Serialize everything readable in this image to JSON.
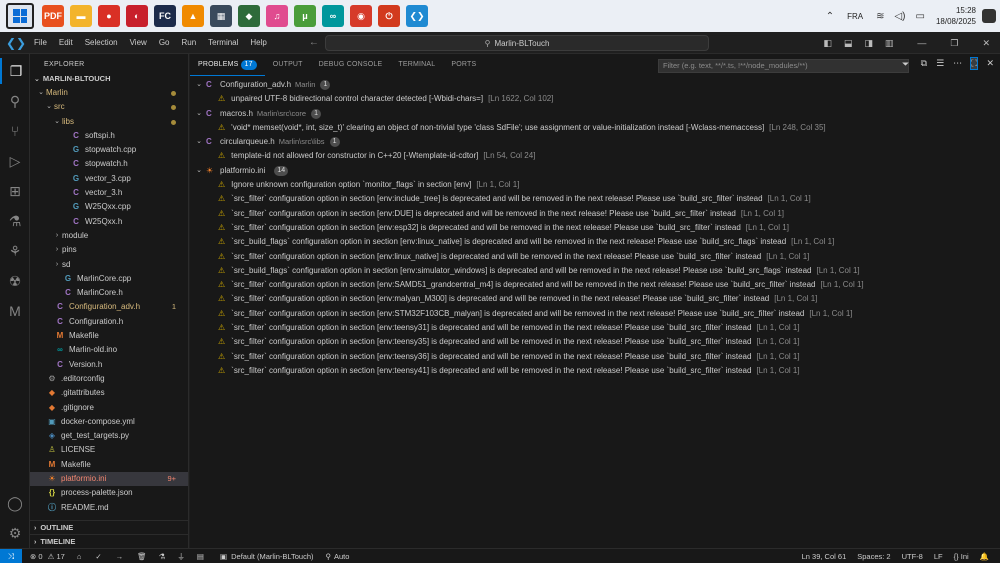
{
  "taskbar": {
    "apps": [
      {
        "icon": "foxit-pdf-icon",
        "glyph": "PDF",
        "color": "#e8501f"
      },
      {
        "icon": "file-explorer-icon",
        "glyph": "▬",
        "color": "#f3b42b"
      },
      {
        "icon": "chrome-icon",
        "glyph": "●",
        "color": "#d93025"
      },
      {
        "icon": "parental-app-icon",
        "glyph": "◐",
        "color": "#c8202c"
      },
      {
        "icon": "fcnx-icon",
        "glyph": "FC",
        "color": "#1c2b4a"
      },
      {
        "icon": "vlc-icon",
        "glyph": "▲",
        "color": "#f08a00"
      },
      {
        "icon": "calculator-icon",
        "glyph": "▦",
        "color": "#3a4a5c"
      },
      {
        "icon": "app-green-icon",
        "glyph": "◆",
        "color": "#2e6b3a"
      },
      {
        "icon": "itunes-icon",
        "glyph": "♫",
        "color": "#e04b8f"
      },
      {
        "icon": "utorrent-icon",
        "glyph": "μ",
        "color": "#4a9d3a"
      },
      {
        "icon": "arduino-icon",
        "glyph": "∞",
        "color": "#00979c"
      },
      {
        "icon": "app-red-icon",
        "glyph": "◉",
        "color": "#d63a2a"
      },
      {
        "icon": "app-power-icon",
        "glyph": "⏻",
        "color": "#d23a1e"
      },
      {
        "icon": "vscode-taskbar-icon",
        "glyph": "❮❯",
        "color": "#1f8ad2"
      }
    ],
    "language": "FRA",
    "time": "15:28",
    "date": "18/08/2025"
  },
  "titlebar": {
    "menu": [
      "File",
      "Edit",
      "Selection",
      "View",
      "Go",
      "Run",
      "Terminal",
      "Help"
    ],
    "search": "Marlin-BLTouch"
  },
  "sidebar": {
    "title": "EXPLORER",
    "project": "MARLIN-BLTOUCH",
    "items": [
      {
        "label": "Marlin",
        "indent": 1,
        "chev": "⌄",
        "icon": "",
        "cls": "mod",
        "dot": true,
        "badge": ""
      },
      {
        "label": "src",
        "indent": 2,
        "chev": "⌄",
        "icon": "",
        "cls": "mod",
        "dot": true,
        "badge": ""
      },
      {
        "label": "libs",
        "indent": 3,
        "chev": "⌄",
        "icon": "",
        "cls": "mod",
        "dot": true,
        "badge": ""
      },
      {
        "label": "softspi.h",
        "indent": 4,
        "chev": "",
        "icon": "C",
        "iconColor": "#a074c4",
        "cls": "",
        "dot": false,
        "badge": ""
      },
      {
        "label": "stopwatch.cpp",
        "indent": 4,
        "chev": "",
        "icon": "G",
        "iconColor": "#519aba",
        "cls": "",
        "dot": false,
        "badge": ""
      },
      {
        "label": "stopwatch.h",
        "indent": 4,
        "chev": "",
        "icon": "C",
        "iconColor": "#a074c4",
        "cls": "",
        "dot": false,
        "badge": ""
      },
      {
        "label": "vector_3.cpp",
        "indent": 4,
        "chev": "",
        "icon": "G",
        "iconColor": "#519aba",
        "cls": "",
        "dot": false,
        "badge": ""
      },
      {
        "label": "vector_3.h",
        "indent": 4,
        "chev": "",
        "icon": "C",
        "iconColor": "#a074c4",
        "cls": "",
        "dot": false,
        "badge": ""
      },
      {
        "label": "W25Qxx.cpp",
        "indent": 4,
        "chev": "",
        "icon": "G",
        "iconColor": "#519aba",
        "cls": "",
        "dot": false,
        "badge": ""
      },
      {
        "label": "W25Qxx.h",
        "indent": 4,
        "chev": "",
        "icon": "C",
        "iconColor": "#a074c4",
        "cls": "",
        "dot": false,
        "badge": ""
      },
      {
        "label": "module",
        "indent": 3,
        "chev": "›",
        "icon": "",
        "cls": "",
        "dot": false,
        "badge": ""
      },
      {
        "label": "pins",
        "indent": 3,
        "chev": "›",
        "icon": "",
        "cls": "",
        "dot": false,
        "badge": ""
      },
      {
        "label": "sd",
        "indent": 3,
        "chev": "›",
        "icon": "",
        "cls": "",
        "dot": false,
        "badge": ""
      },
      {
        "label": "MarlinCore.cpp",
        "indent": 3,
        "chev": "",
        "icon": "G",
        "iconColor": "#519aba",
        "cls": "",
        "dot": false,
        "badge": ""
      },
      {
        "label": "MarlinCore.h",
        "indent": 3,
        "chev": "",
        "icon": "C",
        "iconColor": "#a074c4",
        "cls": "",
        "dot": false,
        "badge": ""
      },
      {
        "label": "Configuration_adv.h",
        "indent": 2,
        "chev": "",
        "icon": "C",
        "iconColor": "#a074c4",
        "cls": "mod",
        "dot": false,
        "badge": "1",
        "badgeColor": "#d7ba7d"
      },
      {
        "label": "Configuration.h",
        "indent": 2,
        "chev": "",
        "icon": "C",
        "iconColor": "#a074c4",
        "cls": "",
        "dot": false,
        "badge": ""
      },
      {
        "label": "Makefile",
        "indent": 2,
        "chev": "",
        "icon": "M",
        "iconColor": "#e37933",
        "cls": "",
        "dot": false,
        "badge": ""
      },
      {
        "label": "Marlin-old.ino",
        "indent": 2,
        "chev": "",
        "icon": "∞",
        "iconColor": "#00979c",
        "cls": "",
        "dot": false,
        "badge": ""
      },
      {
        "label": "Version.h",
        "indent": 2,
        "chev": "",
        "icon": "C",
        "iconColor": "#a074c4",
        "cls": "",
        "dot": false,
        "badge": ""
      },
      {
        "label": ".editorconfig",
        "indent": 1,
        "chev": "",
        "icon": "⚙",
        "iconColor": "#9d9d9d",
        "cls": "",
        "dot": false,
        "badge": ""
      },
      {
        "label": ".gitattributes",
        "indent": 1,
        "chev": "",
        "icon": "◆",
        "iconColor": "#e37933",
        "cls": "",
        "dot": false,
        "badge": ""
      },
      {
        "label": ".gitignore",
        "indent": 1,
        "chev": "",
        "icon": "◆",
        "iconColor": "#e37933",
        "cls": "",
        "dot": false,
        "badge": ""
      },
      {
        "label": "docker-compose.yml",
        "indent": 1,
        "chev": "",
        "icon": "▣",
        "iconColor": "#519aba",
        "cls": "",
        "dot": false,
        "badge": ""
      },
      {
        "label": "get_test_targets.py",
        "indent": 1,
        "chev": "",
        "icon": "◈",
        "iconColor": "#4b8bbe",
        "cls": "",
        "dot": false,
        "badge": ""
      },
      {
        "label": "LICENSE",
        "indent": 1,
        "chev": "",
        "icon": "♙",
        "iconColor": "#cbcb41",
        "cls": "",
        "dot": false,
        "badge": ""
      },
      {
        "label": "Makefile",
        "indent": 1,
        "chev": "",
        "icon": "M",
        "iconColor": "#e37933",
        "cls": "",
        "dot": false,
        "badge": ""
      },
      {
        "label": "platformio.ini",
        "indent": 1,
        "chev": "",
        "icon": "☀",
        "iconColor": "#f5822a",
        "cls": "err",
        "dot": false,
        "badge": "9+",
        "badgeColor": "#f48771",
        "selected": true
      },
      {
        "label": "process-palette.json",
        "indent": 1,
        "chev": "",
        "icon": "{}",
        "iconColor": "#cbcb41",
        "cls": "",
        "dot": false,
        "badge": ""
      },
      {
        "label": "README.md",
        "indent": 1,
        "chev": "",
        "icon": "ⓘ",
        "iconColor": "#519aba",
        "cls": "",
        "dot": false,
        "badge": ""
      }
    ],
    "outline": "OUTLINE",
    "timeline": "TIMELINE"
  },
  "panel": {
    "tabs": [
      {
        "label": "PROBLEMS",
        "badge": "17",
        "active": true
      },
      {
        "label": "OUTPUT",
        "badge": "",
        "active": false
      },
      {
        "label": "DEBUG CONSOLE",
        "badge": "",
        "active": false
      },
      {
        "label": "TERMINAL",
        "badge": "",
        "active": false
      },
      {
        "label": "PORTS",
        "badge": "",
        "active": false
      }
    ],
    "filter_placeholder": "Filter (e.g. text, **/*.ts, !**/node_modules/**)",
    "groups": [
      {
        "file": "Configuration_adv.h",
        "path": "Marlin",
        "count": "1",
        "icon": "C",
        "messages": [
          {
            "text": "unpaired UTF-8 bidirectional control character detected [-Wbidi-chars=]",
            "loc": "[Ln 1622, Col 102]"
          }
        ]
      },
      {
        "file": "macros.h",
        "path": "Marlin\\src\\core",
        "count": "1",
        "icon": "C",
        "messages": [
          {
            "text": "'void* memset(void*, int, size_t)' clearing an object of non-trivial type 'class SdFile'; use assignment or value-initialization instead [-Wclass-memaccess]",
            "loc": "[Ln 248, Col 35]"
          }
        ]
      },
      {
        "file": "circularqueue.h",
        "path": "Marlin\\src\\libs",
        "count": "1",
        "icon": "C",
        "messages": [
          {
            "text": "template-id not allowed for constructor in C++20 [-Wtemplate-id-cdtor]",
            "loc": "[Ln 54, Col 24]"
          }
        ]
      },
      {
        "file": "platformio.ini",
        "path": "",
        "count": "14",
        "icon": "pio",
        "messages": [
          {
            "text": "Ignore unknown configuration option `monitor_flags` in section [env]",
            "loc": "[Ln 1, Col 1]"
          },
          {
            "text": "`src_filter` configuration option in section [env:include_tree] is deprecated and will be removed in the next release! Please use `build_src_filter` instead",
            "loc": "[Ln 1, Col 1]"
          },
          {
            "text": "`src_filter` configuration option in section [env:DUE] is deprecated and will be removed in the next release! Please use `build_src_filter` instead",
            "loc": "[Ln 1, Col 1]"
          },
          {
            "text": "`src_filter` configuration option in section [env:esp32] is deprecated and will be removed in the next release! Please use `build_src_filter` instead",
            "loc": "[Ln 1, Col 1]"
          },
          {
            "text": "`src_build_flags` configuration option in section [env:linux_native] is deprecated and will be removed in the next release! Please use `build_src_flags` instead",
            "loc": "[Ln 1, Col 1]"
          },
          {
            "text": "`src_filter` configuration option in section [env:linux_native] is deprecated and will be removed in the next release! Please use `build_src_filter` instead",
            "loc": "[Ln 1, Col 1]"
          },
          {
            "text": "`src_build_flags` configuration option in section [env:simulator_windows] is deprecated and will be removed in the next release! Please use `build_src_flags` instead",
            "loc": "[Ln 1, Col 1]"
          },
          {
            "text": "`src_filter` configuration option in section [env:SAMD51_grandcentral_m4] is deprecated and will be removed in the next release! Please use `build_src_filter` instead",
            "loc": "[Ln 1, Col 1]"
          },
          {
            "text": "`src_filter` configuration option in section [env:malyan_M300] is deprecated and will be removed in the next release! Please use `build_src_filter` instead",
            "loc": "[Ln 1, Col 1]"
          },
          {
            "text": "`src_filter` configuration option in section [env:STM32F103CB_malyan] is deprecated and will be removed in the next release! Please use `build_src_filter` instead",
            "loc": "[Ln 1, Col 1]"
          },
          {
            "text": "`src_filter` configuration option in section [env:teensy31] is deprecated and will be removed in the next release! Please use `build_src_filter` instead",
            "loc": "[Ln 1, Col 1]"
          },
          {
            "text": "`src_filter` configuration option in section [env:teensy35] is deprecated and will be removed in the next release! Please use `build_src_filter` instead",
            "loc": "[Ln 1, Col 1]"
          },
          {
            "text": "`src_filter` configuration option in section [env:teensy36] is deprecated and will be removed in the next release! Please use `build_src_filter` instead",
            "loc": "[Ln 1, Col 1]"
          },
          {
            "text": "`src_filter` configuration option in section [env:teensy41] is deprecated and will be removed in the next release! Please use `build_src_filter` instead",
            "loc": "[Ln 1, Col 1]"
          }
        ]
      }
    ]
  },
  "statusbar": {
    "errors": "0",
    "warnings": "17",
    "terminal_profile": "Default (Marlin-BLTouch)",
    "auto": "Auto",
    "cursor": "Ln 39, Col 61",
    "spaces": "Spaces: 2",
    "encoding": "UTF-8",
    "eol": "LF",
    "language": "Ini"
  }
}
